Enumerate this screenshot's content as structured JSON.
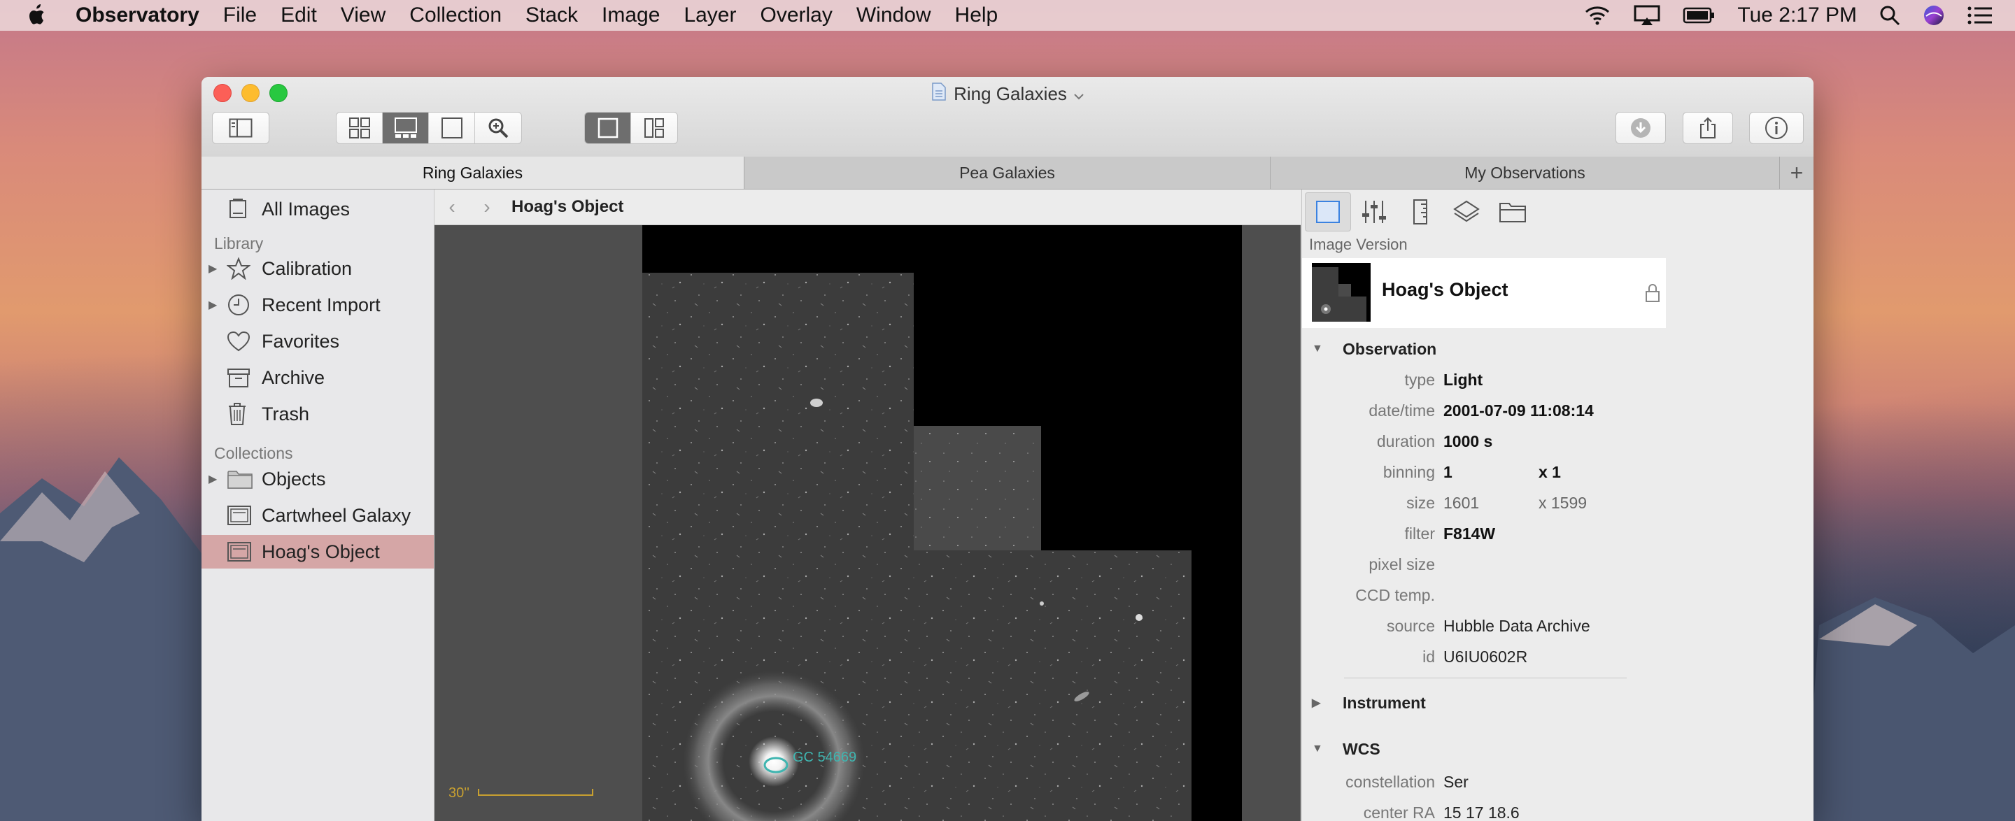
{
  "menubar": {
    "app_name": "Observatory",
    "items": [
      "File",
      "Edit",
      "View",
      "Collection",
      "Stack",
      "Image",
      "Layer",
      "Overlay",
      "Window",
      "Help"
    ],
    "clock": "Tue 2:17 PM"
  },
  "window": {
    "title": "Ring Galaxies",
    "tabs": [
      {
        "label": "Ring Galaxies",
        "active": true
      },
      {
        "label": "Pea Galaxies",
        "active": false
      },
      {
        "label": "My Observations",
        "active": false
      }
    ],
    "add_tab": "+"
  },
  "sidebar": {
    "all_images": "All Images",
    "library_heading": "Library",
    "library": [
      {
        "label": "Calibration",
        "icon": "star-icon",
        "expandable": true
      },
      {
        "label": "Recent Import",
        "icon": "clock-icon",
        "expandable": true
      },
      {
        "label": "Favorites",
        "icon": "heart-icon",
        "expandable": false
      },
      {
        "label": "Archive",
        "icon": "archive-box-icon",
        "expandable": false
      },
      {
        "label": "Trash",
        "icon": "trash-icon",
        "expandable": false
      }
    ],
    "collections_heading": "Collections",
    "collections": [
      {
        "label": "Objects",
        "icon": "folder-icon",
        "expandable": true
      },
      {
        "label": "Cartwheel Galaxy",
        "icon": "image-stack-icon",
        "expandable": false
      },
      {
        "label": "Hoag's Object",
        "icon": "image-stack-icon",
        "expandable": false,
        "selected": true
      }
    ]
  },
  "viewer": {
    "breadcrumb": "Hoag's Object",
    "annotation_label": "GC 54669",
    "scale_label": "30''"
  },
  "inspector": {
    "section_label": "Image Version",
    "version_title": "Hoag's Object",
    "observation_heading": "Observation",
    "observation": {
      "type_k": "type",
      "type_v": "Light",
      "datetime_k": "date/time",
      "datetime_v": "2001-07-09 11:08:14",
      "duration_k": "duration",
      "duration_v": "1000 s",
      "binning_k": "binning",
      "binning_x": "1",
      "binning_y": "x 1",
      "size_k": "size",
      "size_w": "1601",
      "size_h": "x 1599",
      "filter_k": "filter",
      "filter_v": "F814W",
      "pixel_size_k": "pixel size",
      "ccd_temp_k": "CCD temp.",
      "source_k": "source",
      "source_v": "Hubble Data Archive",
      "id_k": "id",
      "id_v": "U6IU0602R"
    },
    "instrument_heading": "Instrument",
    "wcs_heading": "WCS",
    "wcs": {
      "constellation_k": "constellation",
      "constellation_v": "Ser",
      "center_ra_k": "center RA",
      "center_ra_v": "15 17 18.6"
    }
  },
  "colors": {
    "selection": "#d5a6a6",
    "annotation": "#3fb5b0",
    "scale_bar": "#c8a030"
  }
}
